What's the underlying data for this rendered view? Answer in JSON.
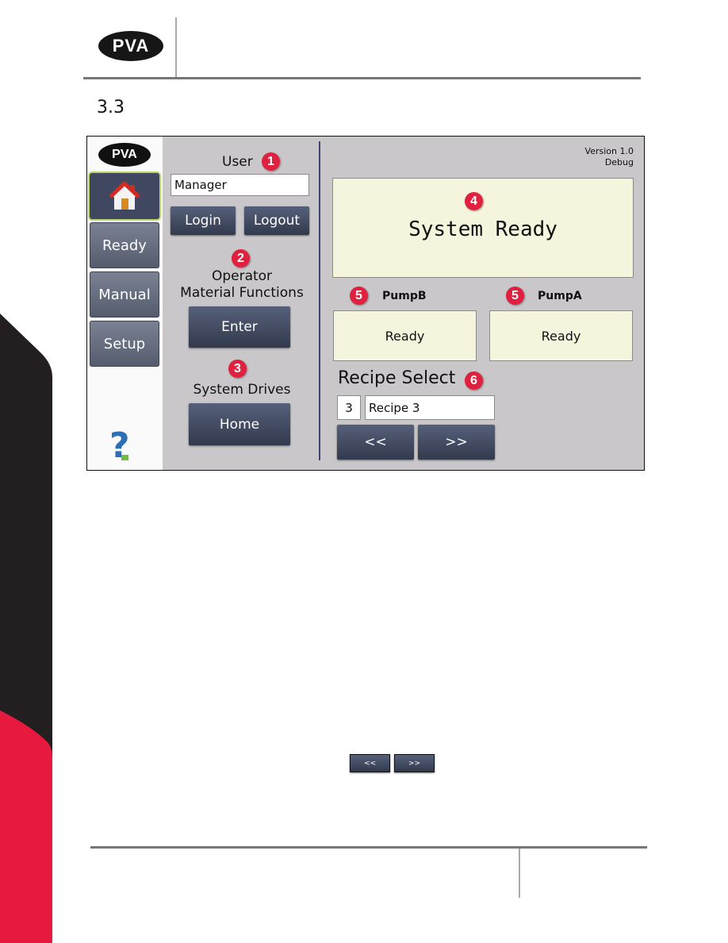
{
  "page": {
    "logo_text": "PVA",
    "section_number": "3.3",
    "colors": {
      "strip_dark": "#231f20",
      "strip_red": "#e8193f",
      "rule": "#777777"
    }
  },
  "hmi": {
    "logo_text": "PVA",
    "sidebar": {
      "items": [
        {
          "label": "",
          "icon": "home-icon",
          "active": true
        },
        {
          "label": "Ready"
        },
        {
          "label": "Manual"
        },
        {
          "label": "Setup"
        }
      ],
      "help_icon": "question-mark-icon"
    },
    "user": {
      "title": "User",
      "badge": "1",
      "value": "Manager",
      "login_label": "Login",
      "logout_label": "Logout"
    },
    "operator": {
      "badge": "2",
      "title_line1": "Operator",
      "title_line2": "Material Functions",
      "enter_label": "Enter"
    },
    "drives": {
      "badge": "3",
      "title": "System Drives",
      "home_label": "Home"
    },
    "version": {
      "line1": "Version 1.0",
      "line2": "Debug"
    },
    "system_status": {
      "badge": "4",
      "text": "System Ready"
    },
    "pumps": [
      {
        "badge": "5",
        "name": "PumpB",
        "status": "Ready"
      },
      {
        "badge": "5",
        "name": "PumpA",
        "status": "Ready"
      }
    ],
    "recipe": {
      "title": "Recipe Select",
      "badge": "6",
      "number": "3",
      "name": "Recipe 3",
      "prev_label": "<<",
      "next_label": ">>"
    },
    "accent_colors": {
      "badge": "#e0203f",
      "button": "#3f4860",
      "status_bg": "#f5f4dc",
      "panel_bg": "#c9c7c9"
    }
  },
  "inline_buttons": {
    "prev_label": "<<",
    "next_label": ">>"
  }
}
